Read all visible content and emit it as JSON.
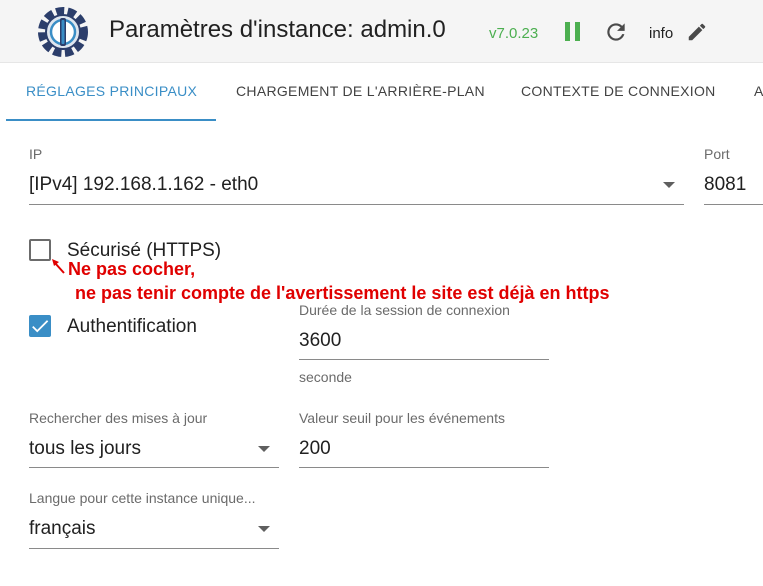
{
  "header": {
    "title": "Paramètres d'instance: admin.0",
    "version": "v7.0.23",
    "info_label": "info"
  },
  "tabs": [
    {
      "label": "RÉGLAGES PRINCIPAUX",
      "active": true
    },
    {
      "label": "CHARGEMENT DE L'ARRIÈRE-PLAN",
      "active": false
    },
    {
      "label": "CONTEXTE DE CONNEXION",
      "active": false
    },
    {
      "label": "A",
      "active": false
    }
  ],
  "form": {
    "ip": {
      "label": "IP",
      "value": "[IPv4] 192.168.1.162 - eth0"
    },
    "port": {
      "label": "Port",
      "value": "8081"
    },
    "secure": {
      "label": "Sécurisé (HTTPS)",
      "checked": false
    },
    "auth": {
      "label": "Authentification",
      "checked": true
    },
    "ttl": {
      "label": "Durée de la session de connexion",
      "value": "3600",
      "unit": "seconde"
    },
    "updates": {
      "label": "Rechercher des mises à jour",
      "value": "tous les jours"
    },
    "threshold": {
      "label": "Valeur seuil pour les événements",
      "value": "200"
    },
    "language": {
      "label": "Langue pour cette instance unique...",
      "value": "français"
    }
  },
  "annotation": {
    "line1": "Ne pas cocher,",
    "line2": "ne pas tenir compte de l'avertissement le site est déjà en https"
  },
  "colors": {
    "accent": "#3a8ec6",
    "running": "#4caf50",
    "annotation": "#e00000"
  }
}
